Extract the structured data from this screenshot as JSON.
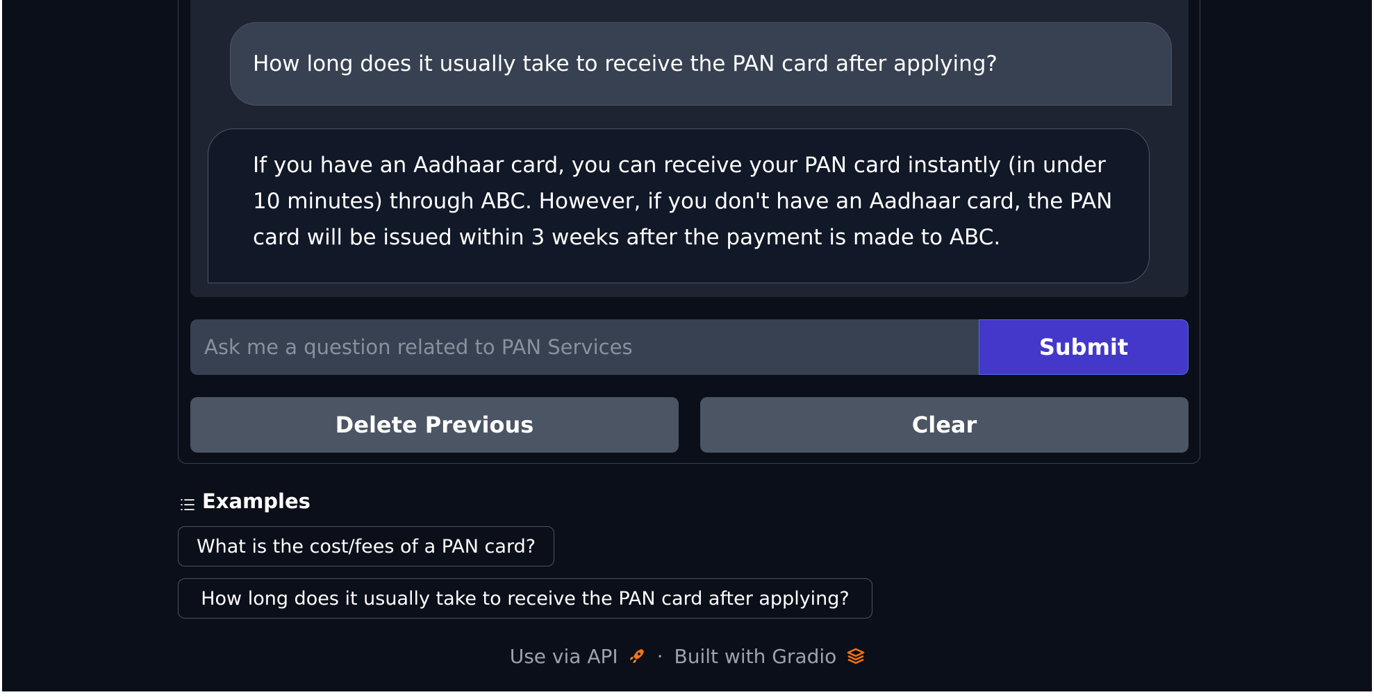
{
  "chat": {
    "messages": [
      {
        "role": "user",
        "text": "How long does it usually take to receive the PAN card after applying?"
      },
      {
        "role": "bot",
        "text": "If you have an Aadhaar card, you can receive your PAN card instantly (in under 10 minutes) through ABC. However, if you don't have an Aadhaar card, the PAN card will be issued within 3 weeks after the payment is made to ABC."
      }
    ]
  },
  "input": {
    "placeholder": "Ask me a question related to PAN Services",
    "value": "",
    "submit_label": "Submit"
  },
  "buttons": {
    "delete_previous": "Delete Previous",
    "clear": "Clear"
  },
  "examples": {
    "header": "Examples",
    "items": [
      "What is the cost/fees of a PAN card?",
      "How long does it usually take to receive the PAN card after applying?"
    ]
  },
  "footer": {
    "api_label": "Use via API",
    "separator": "·",
    "built_with": "Built with Gradio"
  },
  "colors": {
    "background": "#0b0f19",
    "panel": "#1f2433",
    "accent": "#4338ca",
    "icon_orange": "#f97316"
  }
}
